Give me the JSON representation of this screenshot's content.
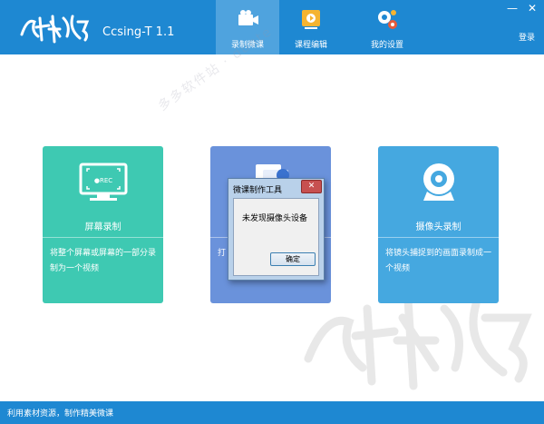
{
  "app": {
    "title": "Ccsing-T 1.1"
  },
  "nav": [
    {
      "label": "录制微课",
      "icon": "recorder-icon"
    },
    {
      "label": "课程编辑",
      "icon": "course-edit-icon"
    },
    {
      "label": "我的设置",
      "icon": "settings-gears-icon"
    }
  ],
  "window_controls": {
    "minimize": "—",
    "close": "✕"
  },
  "login_label": "登录",
  "cards": [
    {
      "title": "屏幕录制",
      "desc": "将整个屏幕或屏幕的一部分录制为一个视频",
      "icon": "screen-rec-icon",
      "icon_text": "●REC",
      "color": "#3ec9b2"
    },
    {
      "title": "",
      "desc": "打",
      "icon": "document-icon",
      "color": "#6a92db"
    },
    {
      "title": "摄像头录制",
      "desc": "将镜头捕捉到的画面录制成一个视频",
      "icon": "webcam-icon",
      "color": "#45a8e0"
    }
  ],
  "dialog": {
    "title": "微课制作工具",
    "close_label": "✕",
    "message": "未发现摄像头设备",
    "ok_label": "确定"
  },
  "footer": {
    "text": "利用素材资源，制作精美微课"
  },
  "colors": {
    "primary": "#1e88d2",
    "nav_active": "#4fa3de"
  }
}
